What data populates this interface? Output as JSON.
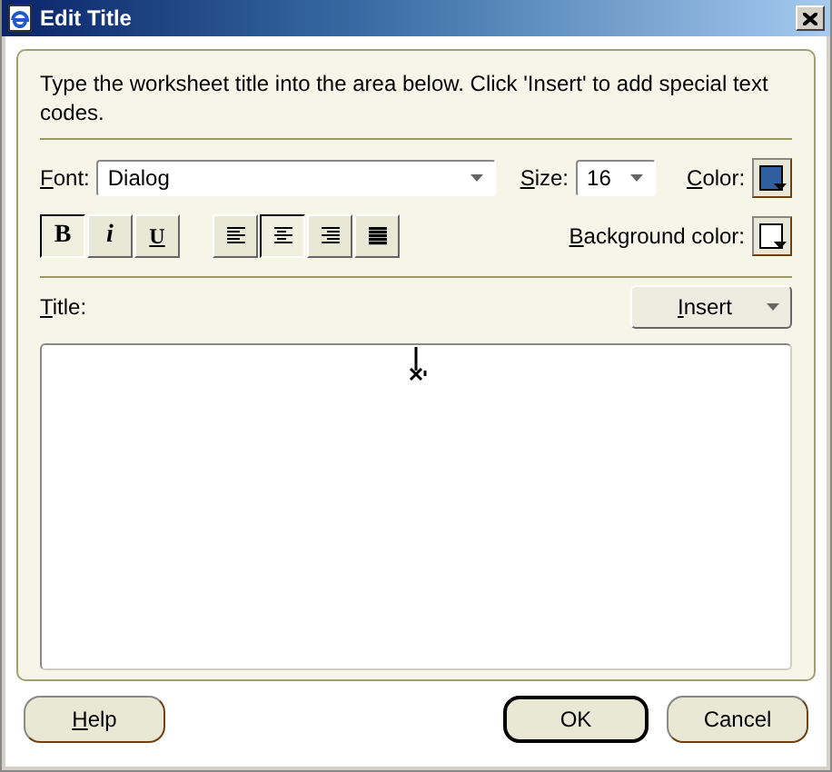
{
  "window": {
    "title": "Edit Title"
  },
  "instructions": "Type the worksheet title into the area below. Click 'Insert' to add special text codes.",
  "font": {
    "label": "Font:",
    "mnemonic": true,
    "value": "Dialog"
  },
  "size": {
    "label": "Size:",
    "mnemonic": true,
    "value": "16"
  },
  "color": {
    "label": "Color:",
    "mnemonic": true,
    "color": "#2f5e9e"
  },
  "style_buttons": [
    {
      "kind": "bold",
      "label": "B",
      "selected": true
    },
    {
      "kind": "italic",
      "label": "i",
      "selected": false
    },
    {
      "kind": "underline",
      "label": "U",
      "selected": false
    }
  ],
  "align_buttons": [
    {
      "kind": "left",
      "selected": false
    },
    {
      "kind": "center",
      "selected": true
    },
    {
      "kind": "right",
      "selected": false
    },
    {
      "kind": "justify",
      "selected": false
    }
  ],
  "background_color": {
    "label": "Background color:",
    "mnemonic": true,
    "color": "#ffffff"
  },
  "title_field": {
    "label": "Title:",
    "mnemonic": true
  },
  "insert": {
    "label": "Insert",
    "mnemonic": true
  },
  "buttons": [
    {
      "kind": "help",
      "label": "Help",
      "mnemonic": true,
      "default": false
    },
    {
      "kind": "ok",
      "label": "OK",
      "mnemonic": false,
      "default": true
    },
    {
      "kind": "cancel",
      "label": "Cancel",
      "mnemonic": false,
      "default": false
    }
  ]
}
